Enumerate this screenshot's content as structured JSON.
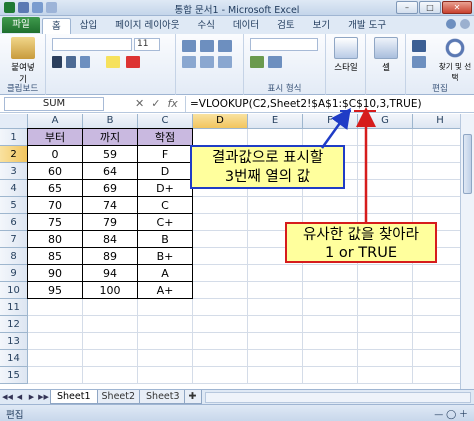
{
  "window": {
    "title": "통합 문서1 - Microsoft Excel",
    "minimize": "–",
    "maximize": "□",
    "close": "✕"
  },
  "ribbon": {
    "file_tab": "파일",
    "tabs": [
      "홈",
      "삽입",
      "페이지 레이아웃",
      "수식",
      "데이터",
      "검토",
      "보기",
      "개발 도구"
    ],
    "groups": {
      "clipboard": "클립보드",
      "paste": "붙여넣기",
      "font_size": "11",
      "number": "표시 형식",
      "styles_btn": "스타일",
      "cells_btn": "셀",
      "find_select": "찾기 및 선택",
      "editing": "편집"
    }
  },
  "formula_bar": {
    "name_box": "SUM",
    "cancel": "✕",
    "enter": "✓",
    "fx": "fx",
    "formula": "=VLOOKUP(C2,Sheet2!$A$1:$C$10,3,TRUE)"
  },
  "grid": {
    "columns": [
      "A",
      "B",
      "C",
      "D",
      "E",
      "F",
      "G",
      "H"
    ],
    "rows": [
      "1",
      "2",
      "3",
      "4",
      "5",
      "6",
      "7",
      "8",
      "9",
      "10",
      "11",
      "12",
      "13",
      "14",
      "15"
    ],
    "headers": [
      "부터",
      "까지",
      "학점"
    ],
    "data": [
      [
        "0",
        "59",
        "F"
      ],
      [
        "60",
        "64",
        "D"
      ],
      [
        "65",
        "69",
        "D+"
      ],
      [
        "70",
        "74",
        "C"
      ],
      [
        "75",
        "79",
        "C+"
      ],
      [
        "80",
        "84",
        "B"
      ],
      [
        "85",
        "89",
        "B+"
      ],
      [
        "90",
        "94",
        "A"
      ],
      [
        "95",
        "100",
        "A+"
      ]
    ]
  },
  "callouts": {
    "blue": [
      "결과값으로 표시할",
      "3번째 열의 값"
    ],
    "red": [
      "유사한 값을 찾아라",
      "1 or TRUE"
    ]
  },
  "sheets": [
    "Sheet1",
    "Sheet2",
    "Sheet3"
  ],
  "nav": [
    "◀◀",
    "◀",
    "▶",
    "▶▶"
  ],
  "status": {
    "mode": "편집"
  },
  "colors": {
    "header_fill": "#c9b9e0",
    "callout_fill": "#ffff9d",
    "blue_border": "#1f3cc6",
    "red_border": "#d61c1c"
  }
}
